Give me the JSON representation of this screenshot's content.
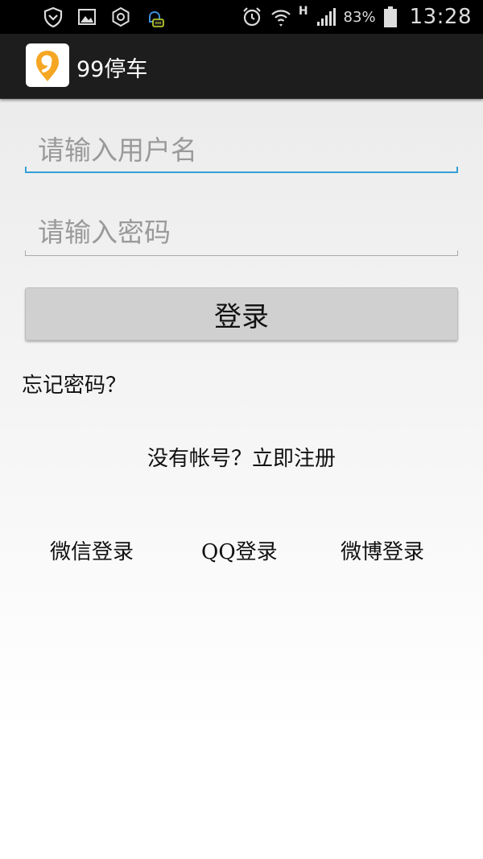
{
  "status_bar": {
    "battery_percent": "83%",
    "network_type": "H",
    "time": "13:28"
  },
  "action_bar": {
    "app_title": "99停车",
    "logo_text": "9",
    "logo_color": "#f5a623"
  },
  "form": {
    "username_placeholder": "请输入用户名",
    "username_value": "",
    "password_placeholder": "请输入密码",
    "password_value": "",
    "focus_color": "#33a0d6"
  },
  "login_button": "登录",
  "links": {
    "forgot_password": "忘记密码？",
    "register": "没有帐号？立即注册"
  },
  "social_login": {
    "wechat": "微信登录",
    "qq": "QQ登录",
    "weibo": "微博登录"
  }
}
